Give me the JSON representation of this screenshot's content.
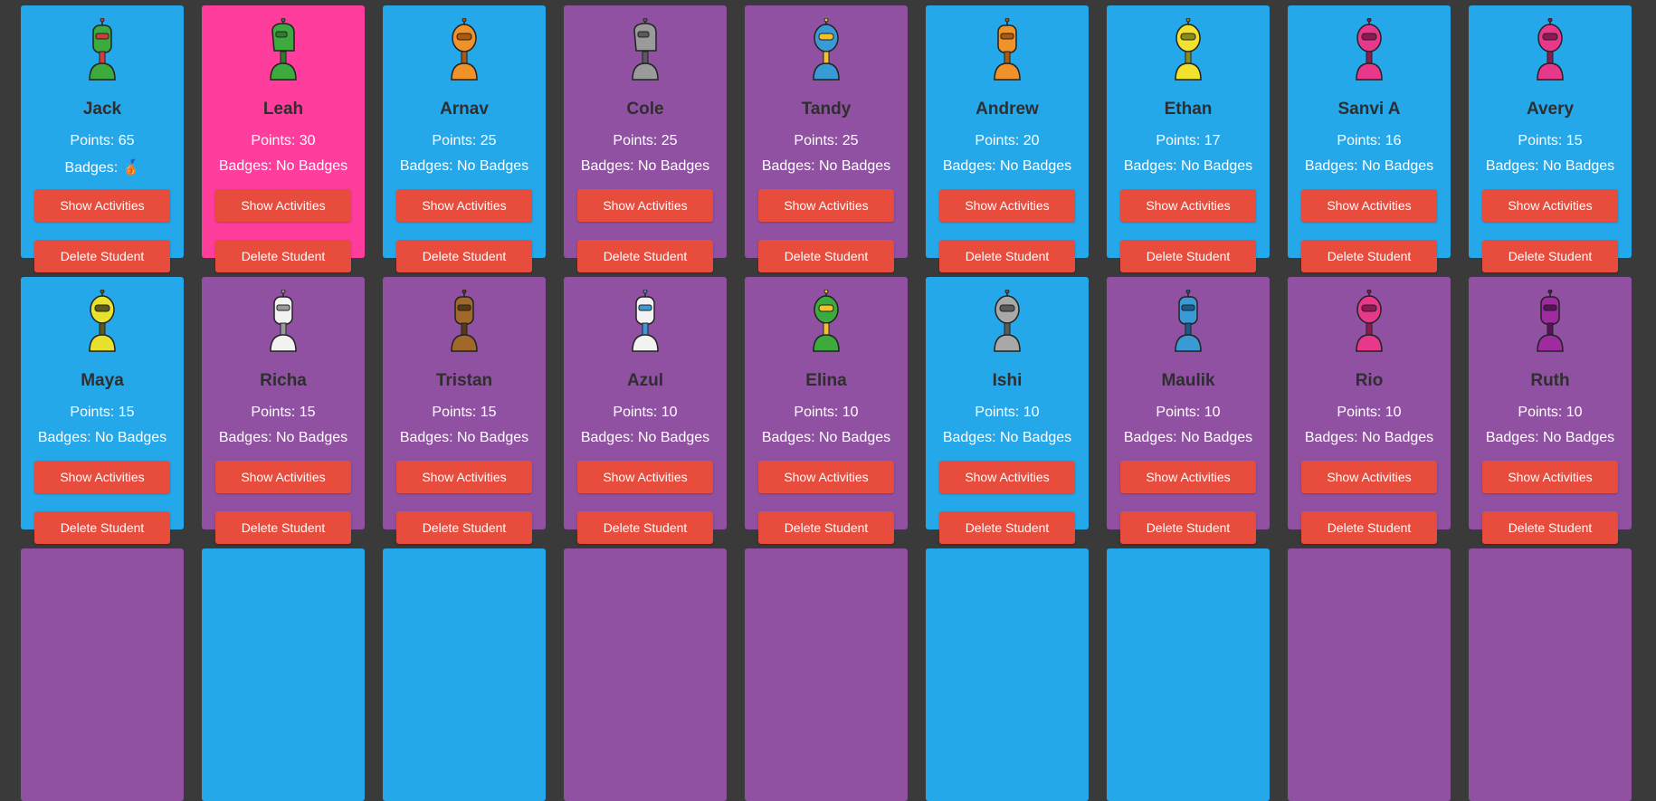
{
  "labels": {
    "points_prefix": "Points: ",
    "badges_prefix": "Badges: ",
    "show_activities": "Show Activities",
    "delete_student": "Delete Student"
  },
  "colors": {
    "blue": "#25a8ea",
    "purple": "#9151a3",
    "pink": "#ff3d9c",
    "button": "#e74c3c",
    "background": "#3a3a3a"
  },
  "students": [
    {
      "name": "Jack",
      "points": "65",
      "badges": "🥉",
      "color": "blue",
      "avatar": {
        "body": "#3caa3c",
        "accent": "#d23c3c",
        "shape": "tall"
      }
    },
    {
      "name": "Leah",
      "points": "30",
      "badges": "No Badges",
      "color": "pink",
      "avatar": {
        "body": "#3caa3c",
        "accent": "#2e7d2e",
        "shape": "hook"
      }
    },
    {
      "name": "Arnav",
      "points": "25",
      "badges": "No Badges",
      "color": "blue",
      "avatar": {
        "body": "#f0922a",
        "accent": "#a85a10",
        "shape": "round"
      }
    },
    {
      "name": "Cole",
      "points": "25",
      "badges": "No Badges",
      "color": "purple",
      "avatar": {
        "body": "#9a9a9a",
        "accent": "#5a5a5a",
        "shape": "hook"
      }
    },
    {
      "name": "Tandy",
      "points": "25",
      "badges": "No Badges",
      "color": "purple",
      "avatar": {
        "body": "#3a9ad6",
        "accent": "#f2c12e",
        "shape": "round"
      }
    },
    {
      "name": "Andrew",
      "points": "20",
      "badges": "No Badges",
      "color": "blue",
      "avatar": {
        "body": "#f0922a",
        "accent": "#a85a10",
        "shape": "tall"
      }
    },
    {
      "name": "Ethan",
      "points": "17",
      "badges": "No Badges",
      "color": "blue",
      "avatar": {
        "body": "#f2e22e",
        "accent": "#8a8a1a",
        "shape": "round"
      }
    },
    {
      "name": "Sanvi A",
      "points": "16",
      "badges": "No Badges",
      "color": "blue",
      "avatar": {
        "body": "#e8388c",
        "accent": "#8a1a50",
        "shape": "round"
      }
    },
    {
      "name": "Avery",
      "points": "15",
      "badges": "No Badges",
      "color": "blue",
      "avatar": {
        "body": "#e8388c",
        "accent": "#8a1a50",
        "shape": "round"
      }
    },
    {
      "name": "Maya",
      "points": "15",
      "badges": "No Badges",
      "color": "blue",
      "avatar": {
        "body": "#e8e22e",
        "accent": "#5a5a1a",
        "shape": "round"
      }
    },
    {
      "name": "Richa",
      "points": "15",
      "badges": "No Badges",
      "color": "purple",
      "avatar": {
        "body": "#f2f2f2",
        "accent": "#9a9a9a",
        "shape": "tall"
      }
    },
    {
      "name": "Tristan",
      "points": "15",
      "badges": "No Badges",
      "color": "purple",
      "avatar": {
        "body": "#a0682a",
        "accent": "#5a3a10",
        "shape": "tall"
      }
    },
    {
      "name": "Azul",
      "points": "10",
      "badges": "No Badges",
      "color": "purple",
      "avatar": {
        "body": "#f2f2f2",
        "accent": "#3a9ad6",
        "shape": "tall"
      }
    },
    {
      "name": "Elina",
      "points": "10",
      "badges": "No Badges",
      "color": "purple",
      "avatar": {
        "body": "#3caa3c",
        "accent": "#f2c12e",
        "shape": "round"
      }
    },
    {
      "name": "Ishi",
      "points": "10",
      "badges": "No Badges",
      "color": "blue",
      "avatar": {
        "body": "#a8a8a8",
        "accent": "#5a5a5a",
        "shape": "round"
      }
    },
    {
      "name": "Maulik",
      "points": "10",
      "badges": "No Badges",
      "color": "purple",
      "avatar": {
        "body": "#3a9ad6",
        "accent": "#1a5a8a",
        "shape": "tall"
      }
    },
    {
      "name": "Rio",
      "points": "10",
      "badges": "No Badges",
      "color": "purple",
      "avatar": {
        "body": "#e8388c",
        "accent": "#8a1a50",
        "shape": "round"
      }
    },
    {
      "name": "Ruth",
      "points": "10",
      "badges": "No Badges",
      "color": "purple",
      "avatar": {
        "body": "#a02aa0",
        "accent": "#5a105a",
        "shape": "tall"
      }
    },
    {
      "name": "",
      "points": "",
      "badges": "",
      "color": "purple",
      "avatar": {
        "body": "#9151a3",
        "accent": "#9151a3",
        "shape": "none"
      }
    },
    {
      "name": "",
      "points": "",
      "badges": "",
      "color": "blue",
      "avatar": {
        "body": "#25a8ea",
        "accent": "#25a8ea",
        "shape": "none"
      }
    },
    {
      "name": "",
      "points": "",
      "badges": "",
      "color": "blue",
      "avatar": {
        "body": "#25a8ea",
        "accent": "#25a8ea",
        "shape": "none"
      }
    },
    {
      "name": "",
      "points": "",
      "badges": "",
      "color": "purple",
      "avatar": {
        "body": "#9151a3",
        "accent": "#9151a3",
        "shape": "none"
      }
    },
    {
      "name": "",
      "points": "",
      "badges": "",
      "color": "purple",
      "avatar": {
        "body": "#9151a3",
        "accent": "#9151a3",
        "shape": "none"
      }
    },
    {
      "name": "",
      "points": "",
      "badges": "",
      "color": "blue",
      "avatar": {
        "body": "#25a8ea",
        "accent": "#25a8ea",
        "shape": "none"
      }
    },
    {
      "name": "",
      "points": "",
      "badges": "",
      "color": "blue",
      "avatar": {
        "body": "#25a8ea",
        "accent": "#25a8ea",
        "shape": "none"
      }
    },
    {
      "name": "",
      "points": "",
      "badges": "",
      "color": "purple",
      "avatar": {
        "body": "#9151a3",
        "accent": "#9151a3",
        "shape": "none"
      }
    },
    {
      "name": "",
      "points": "",
      "badges": "",
      "color": "purple",
      "avatar": {
        "body": "#9151a3",
        "accent": "#9151a3",
        "shape": "none"
      }
    }
  ]
}
